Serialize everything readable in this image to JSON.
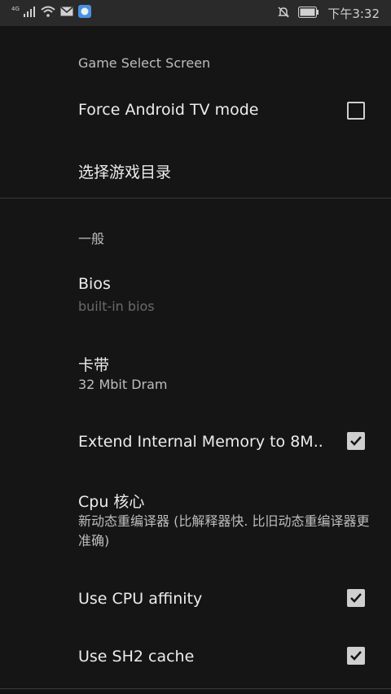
{
  "status_bar": {
    "network_label": "4G",
    "time": "下午3:32",
    "icons": [
      "signal-icon",
      "wifi-icon",
      "mail-icon",
      "app-notification-icon",
      "mute-bell-icon",
      "battery-icon"
    ]
  },
  "sections": [
    {
      "header": "Game Select Screen",
      "items": [
        {
          "title": "Force Android TV mode",
          "checkbox": true,
          "checked": false
        },
        {
          "title": "选择游戏目录"
        }
      ]
    },
    {
      "header": "一般",
      "items": [
        {
          "title": "Bios",
          "summary": "built-in bios",
          "summary_disabled": true
        },
        {
          "title": "卡带",
          "summary": "32 Mbit Dram"
        },
        {
          "title": "Extend Internal Memory to 8M..",
          "checkbox": true,
          "checked": true
        },
        {
          "title": "Cpu 核心",
          "summary": "新动态重编译器 (比解释器快. 比旧动态重编译器更准确)"
        },
        {
          "title": "Use CPU affinity",
          "checkbox": true,
          "checked": true
        },
        {
          "title": "Use SH2 cache",
          "checkbox": true,
          "checked": true
        }
      ]
    }
  ],
  "colors": {
    "background": "#151515",
    "status_bar": "#2a2a2a",
    "text": "#ececec",
    "secondary_text": "#bdbdbd",
    "checkbox": "#cfcfcf"
  }
}
